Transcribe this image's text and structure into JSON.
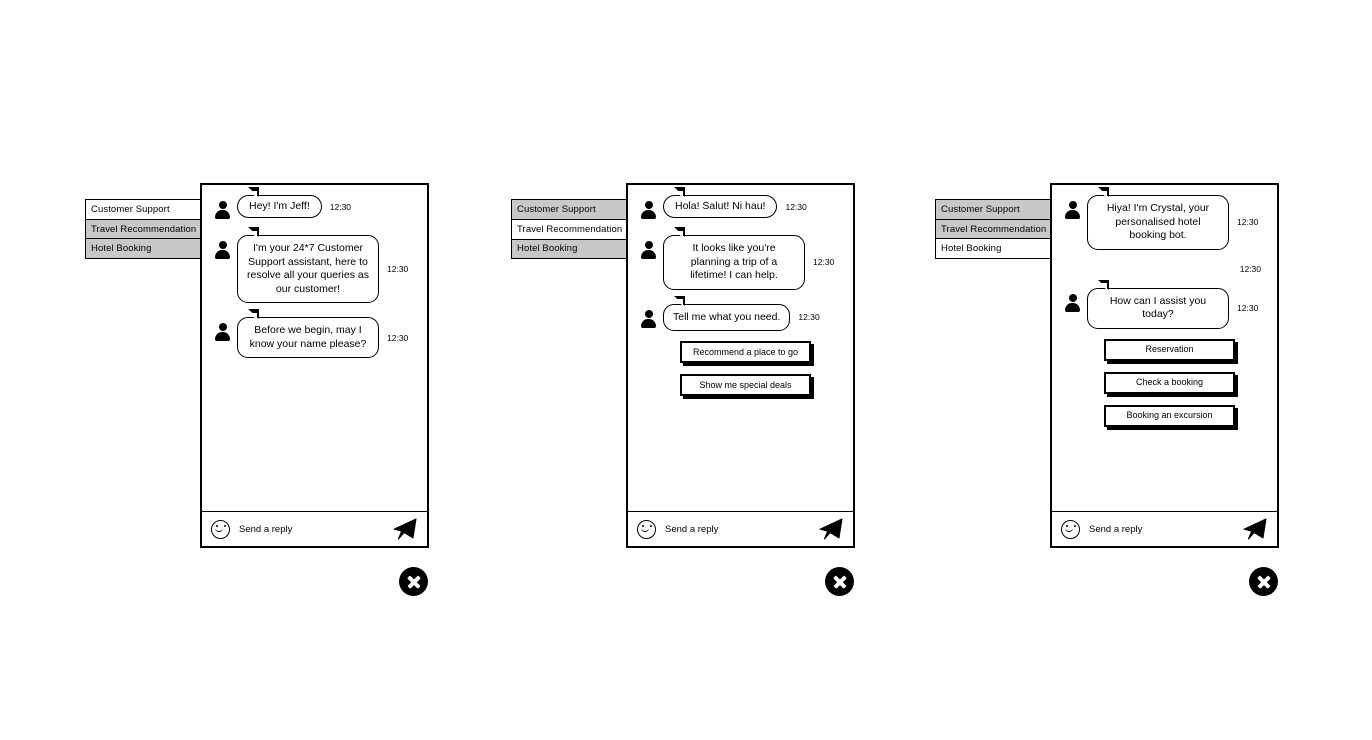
{
  "panels": [
    {
      "id": "customer-support",
      "tabs": [
        {
          "label": "Customer Support",
          "active": true
        },
        {
          "label": "Travel Recommendation",
          "active": false
        },
        {
          "label": "Hotel Booking",
          "active": false
        }
      ],
      "messages": [
        {
          "type": "bubble",
          "shape": "pill",
          "text": "Hey! I'm Jeff!",
          "time": "12:30"
        },
        {
          "type": "bubble",
          "shape": "box",
          "text": "I'm your 24*7 Customer Support assistant, here to resolve all your queries as our customer!",
          "time": "12:30"
        },
        {
          "type": "bubble",
          "shape": "box",
          "text": "Before we begin, may I know your name please?",
          "time": "12:30"
        }
      ],
      "quick_replies": [],
      "input": {
        "placeholder": "Send a reply",
        "smiley_icon": "smiley-icon",
        "send_icon": "paper-plane-icon"
      },
      "close_icon": "close-circle-icon"
    },
    {
      "id": "travel-recommendation",
      "tabs": [
        {
          "label": "Customer Support",
          "active": false
        },
        {
          "label": "Travel Recommendation",
          "active": true
        },
        {
          "label": "Hotel Booking",
          "active": false
        }
      ],
      "messages": [
        {
          "type": "bubble",
          "shape": "pill",
          "text": "Hola! Salut! Ni hau!",
          "time": "12:30"
        },
        {
          "type": "bubble",
          "shape": "box",
          "text": "It looks like you're planning a trip of a lifetime!  I can help.",
          "time": "12:30"
        },
        {
          "type": "bubble",
          "shape": "box",
          "text": "Tell me what you need.",
          "time": "12:30"
        }
      ],
      "quick_replies": [
        "Recommend a place to go",
        "Show me special deals"
      ],
      "input": {
        "placeholder": "Send a reply",
        "smiley_icon": "smiley-icon",
        "send_icon": "paper-plane-icon"
      },
      "close_icon": "close-circle-icon"
    },
    {
      "id": "hotel-booking",
      "tabs": [
        {
          "label": "Customer Support",
          "active": false
        },
        {
          "label": "Travel Recommendation",
          "active": false
        },
        {
          "label": "Hotel Booking",
          "active": true
        }
      ],
      "messages": [
        {
          "type": "bubble",
          "shape": "box",
          "text": "Hiya! I'm Crystal, your personalised hotel booking bot.",
          "time": "12:30"
        },
        {
          "type": "time-only",
          "time": "12:30"
        },
        {
          "type": "bubble",
          "shape": "box",
          "text": "How can I assist you today?",
          "time": "12:30"
        }
      ],
      "quick_replies": [
        "Reservation",
        "Check a booking",
        "Booking an excursion"
      ],
      "input": {
        "placeholder": "Send a reply",
        "smiley_icon": "smiley-icon",
        "send_icon": "paper-plane-icon"
      },
      "close_icon": "close-circle-icon"
    }
  ],
  "colors": {
    "tab_inactive": "#c8c8c8",
    "tab_active": "#ffffff",
    "stroke": "#000000",
    "canvas": "#ffffff"
  }
}
